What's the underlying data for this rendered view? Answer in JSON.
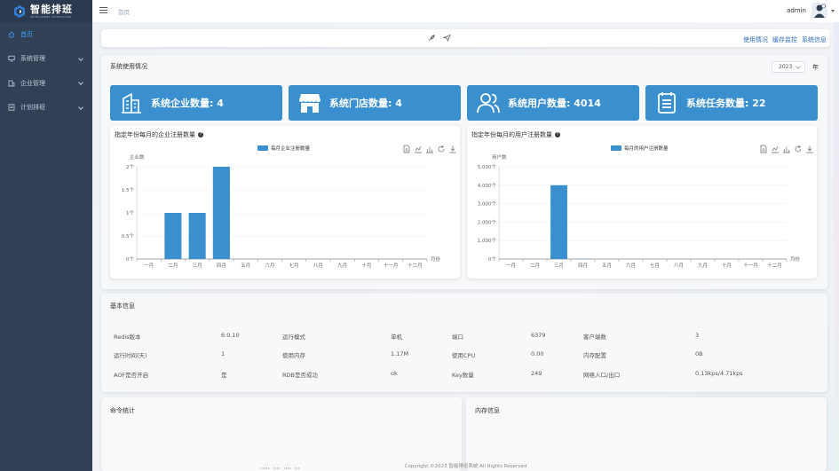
{
  "app": {
    "title": "智能排班",
    "subtitle": "INTELLIGENT SCHEDULING"
  },
  "colors": {
    "sidebar_bg": "#304156",
    "accent": "#409eff",
    "stat_card": "#3a8fce",
    "bar": "#3a8fce"
  },
  "sidebar": {
    "items": [
      {
        "label": "首页",
        "icon": "home-icon",
        "active": true
      },
      {
        "label": "系统管理",
        "icon": "monitor-icon",
        "expandable": true
      },
      {
        "label": "企业管理",
        "icon": "building-icon",
        "expandable": true
      },
      {
        "label": "计划排班",
        "icon": "schedule-icon",
        "expandable": true
      }
    ]
  },
  "header": {
    "breadcrumb": "首页",
    "user": "admin"
  },
  "toolbar": {
    "links": [
      "使用情况",
      "缓存监控",
      "系统信息"
    ]
  },
  "usage": {
    "title": "系统使用情况",
    "year": "2023",
    "year_unit": "年",
    "stats": [
      {
        "label": "系统企业数量: 4",
        "icon": "building-icon"
      },
      {
        "label": "系统门店数量: 4",
        "icon": "store-icon"
      },
      {
        "label": "系统用户数量: 4014",
        "icon": "users-icon"
      },
      {
        "label": "系统任务数量: 22",
        "icon": "calendar-icon"
      }
    ]
  },
  "chart_data": [
    {
      "type": "bar",
      "title": "指定年份每月的企业注册数量",
      "legend": "每月企业注册数量",
      "ylabel": "企业数",
      "xlabel": "月份",
      "categories": [
        "一月",
        "二月",
        "三月",
        "四月",
        "五月",
        "六月",
        "七月",
        "八月",
        "九月",
        "十月",
        "十一月",
        "十二月"
      ],
      "values": [
        0,
        1,
        1,
        2,
        0,
        0,
        0,
        0,
        0,
        0,
        0,
        0
      ],
      "yticks": [
        "0个",
        "0.5个",
        "1个",
        "1.5个",
        "2个"
      ],
      "ylim": [
        0,
        2
      ]
    },
    {
      "type": "bar",
      "title": "指定年份每月的用户注册数量",
      "legend": "每月的用户注册数量",
      "ylabel": "用户数",
      "xlabel": "月份",
      "categories": [
        "一月",
        "二月",
        "三月",
        "四月",
        "五月",
        "六月",
        "七月",
        "八月",
        "九月",
        "十月",
        "十一月",
        "十二月"
      ],
      "values": [
        0,
        0,
        4000,
        14,
        0,
        0,
        0,
        0,
        0,
        0,
        0,
        0
      ],
      "yticks": [
        "0个",
        "1,000个",
        "2,000个",
        "3,000个",
        "4,000个",
        "5,000个"
      ],
      "ylim": [
        0,
        5000
      ]
    }
  ],
  "basic": {
    "title": "基本信息",
    "rows": [
      [
        "Redis版本",
        "6.0.10",
        "运行模式",
        "单机",
        "端口",
        "6379",
        "客户端数",
        "3"
      ],
      [
        "运行时间(天)",
        "1",
        "使用内存",
        "1.17M",
        "使用CPU",
        "0.00",
        "内存配置",
        "0B"
      ],
      [
        "AOF是否开启",
        "是",
        "RDB是否成功",
        "ok",
        "Key数量",
        "249",
        "网络入口/出口",
        "0.13kps/4.71kps"
      ]
    ]
  },
  "command_stats": {
    "title": "命令统计"
  },
  "memory_info": {
    "title": "内存信息"
  },
  "footer": "Copyright ©2023 智能排班系统 All Rights Reserved"
}
